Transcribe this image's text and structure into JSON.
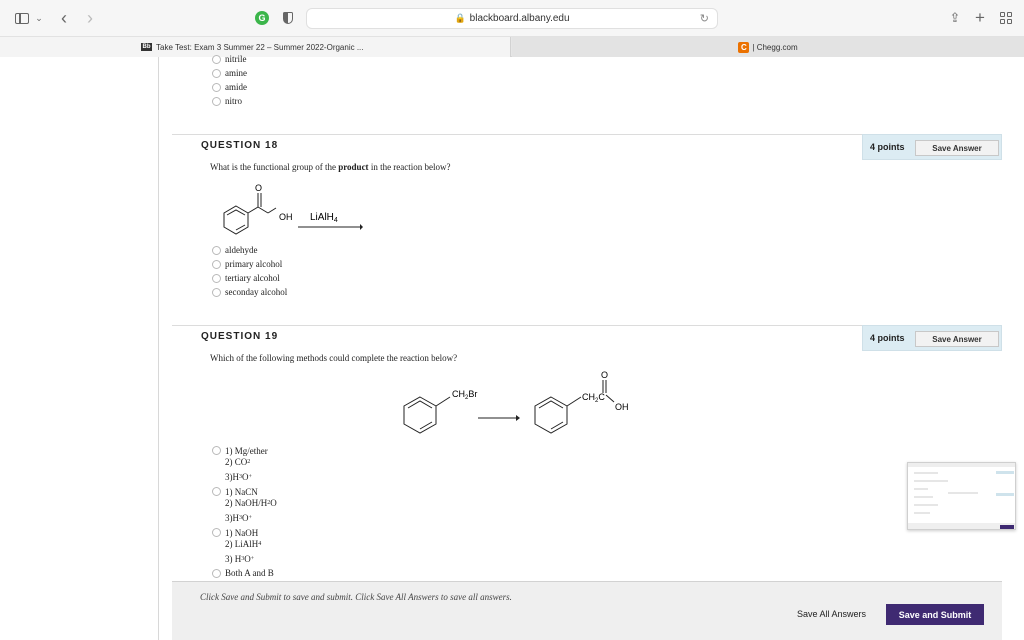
{
  "browser": {
    "url": "blackboard.albany.edu",
    "tabs": [
      {
        "favicon": "Bb",
        "label": "Take Test: Exam 3 Summer 22 – Summer 2022-Organic ..."
      },
      {
        "favicon": "C",
        "label": "| Chegg.com"
      }
    ]
  },
  "prev_question": {
    "options": [
      "nitrile",
      "amine",
      "amide",
      "nitro"
    ]
  },
  "question18": {
    "title": "QUESTION 18",
    "points": "4 points",
    "save_label": "Save Answer",
    "text_before": "What is the functional group of the ",
    "text_bold": "product",
    "text_after": " in the reaction below?",
    "reaction": {
      "reagent": "LiAlH",
      "reagent_sub": "4",
      "oh": "OH",
      "o": "O"
    },
    "options": [
      "aldehyde",
      "primary alcohol",
      "tertiary alcohol",
      "seconday alcohol"
    ]
  },
  "question19": {
    "title": "QUESTION 19",
    "points": "4 points",
    "save_label": "Save Answer",
    "text": "Which of the following methods could complete the reaction below?",
    "reaction": {
      "reactant_label": "CH",
      "reactant_sub": "2",
      "reactant_end": "Br",
      "product_label": "CH",
      "product_sub": "2",
      "product_c": "C",
      "oh": "OH",
      "o": "O"
    },
    "options": [
      {
        "l1": "1) Mg/ether",
        "l2a": "2) CO",
        "l2s": "2",
        "l3a": "3)H",
        "l3s": "3",
        "l3b": "O",
        "l3p": "+"
      },
      {
        "l1": "1) NaCN",
        "l2a": "2) NaOH/H",
        "l2s": "2",
        "l2b": "O",
        "l3a": "3)H",
        "l3s": "3",
        "l3b": "O",
        "l3p": "+"
      },
      {
        "l1": "1) NaOH",
        "l2a": "2) LiAlH",
        "l2s": "4",
        "l3a": "3) H",
        "l3s": "3",
        "l3b": "O",
        "l3p": "+"
      },
      {
        "l1": "Both A and B"
      }
    ]
  },
  "footer": {
    "note": "Click Save and Submit to save and submit. Click Save All Answers to save all answers.",
    "save_all": "Save All Answers",
    "save_submit": "Save and Submit"
  }
}
